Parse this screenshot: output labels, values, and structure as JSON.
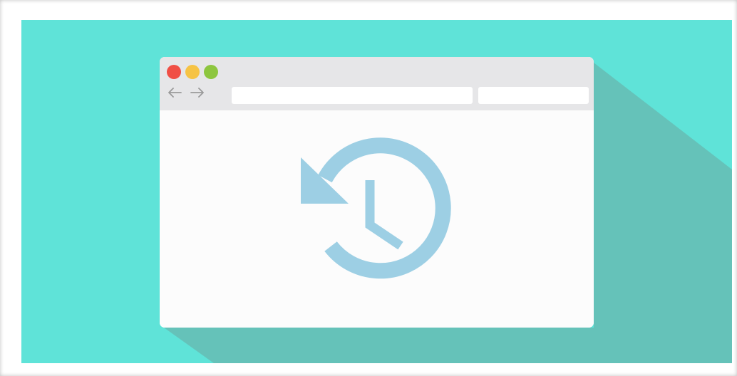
{
  "colors": {
    "background": "#5fe3d8",
    "shadow": "#65c2b9",
    "browser_body": "#fcfcfc",
    "toolbar": "#e6e6e8",
    "close_dot": "#f04f45",
    "minimize_dot": "#f6c344",
    "maximize_dot": "#8dc63f",
    "arrows": "#9a9a9a",
    "history_icon": "#9dcfe4"
  },
  "icons": {
    "window_controls": [
      "close-dot",
      "minimize-dot",
      "maximize-dot"
    ],
    "navigation": [
      "back-arrow-icon",
      "forward-arrow-icon"
    ],
    "main": "history-icon"
  }
}
